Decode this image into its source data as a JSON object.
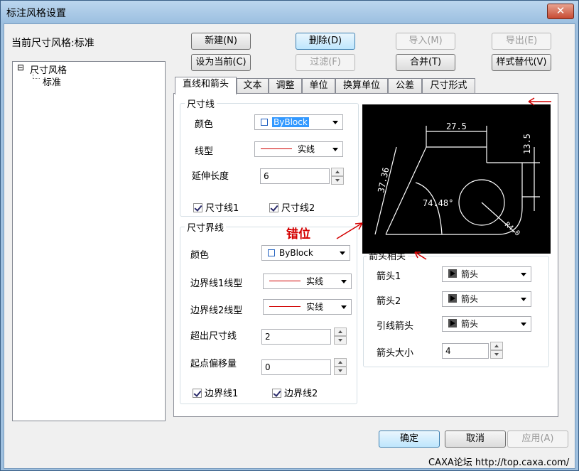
{
  "window": {
    "title": "标注风格设置",
    "close_glyph": "✕"
  },
  "current_style": {
    "label": "当前尺寸风格:标准"
  },
  "buttons": {
    "new": "新建(N)",
    "delete": "删除(D)",
    "import": "导入(M)",
    "export": "导出(E)",
    "set_current": "设为当前(C)",
    "filter": "过滤(F)",
    "merge": "合并(T)",
    "override": "样式替代(V)",
    "ok": "确定",
    "cancel": "取消",
    "apply": "应用(A)"
  },
  "tree": {
    "expander": "⊟",
    "root": "尺寸风格",
    "child": "标准"
  },
  "tabs": [
    {
      "label": "直线和箭头"
    },
    {
      "label": "文本"
    },
    {
      "label": "调整"
    },
    {
      "label": "单位"
    },
    {
      "label": "换算单位"
    },
    {
      "label": "公差"
    },
    {
      "label": "尺寸形式"
    }
  ],
  "dim_line": {
    "group_title": "尺寸线",
    "color_label": "颜色",
    "color_value": "ByBlock",
    "linetype_label": "线型",
    "linetype_value": "实线",
    "extend_label": "延伸长度",
    "extend_value": "6",
    "check1": "尺寸线1",
    "check2": "尺寸线2"
  },
  "ext_line": {
    "group_title": "尺寸界线",
    "color_label": "颜色",
    "color_value": "ByBlock",
    "type1_label": "边界线1线型",
    "type1_value": "实线",
    "type2_label": "边界线2线型",
    "type2_value": "实线",
    "beyond_label": "超出尺寸线",
    "beyond_value": "2",
    "offset_label": "起点偏移量",
    "offset_value": "0",
    "check1": "边界线1",
    "check2": "边界线2"
  },
  "arrows": {
    "group_title": "箭头相关",
    "arrow1_label": "箭头1",
    "arrow1_value": "箭头",
    "arrow2_label": "箭头2",
    "arrow2_value": "箭头",
    "leader_label": "引线箭头",
    "leader_value": "箭头",
    "size_label": "箭头大小",
    "size_value": "4"
  },
  "preview": {
    "dim_top": "27.5",
    "dim_right": "13.5",
    "dim_left": "37.36",
    "dim_angle": "74.48°",
    "dim_radius": "R4.0"
  },
  "annotation": {
    "text": "错位",
    "color": "#d40000",
    "arrow_glyph": "↙"
  },
  "credit": "CAXA论坛 http://top.caxa.com/"
}
